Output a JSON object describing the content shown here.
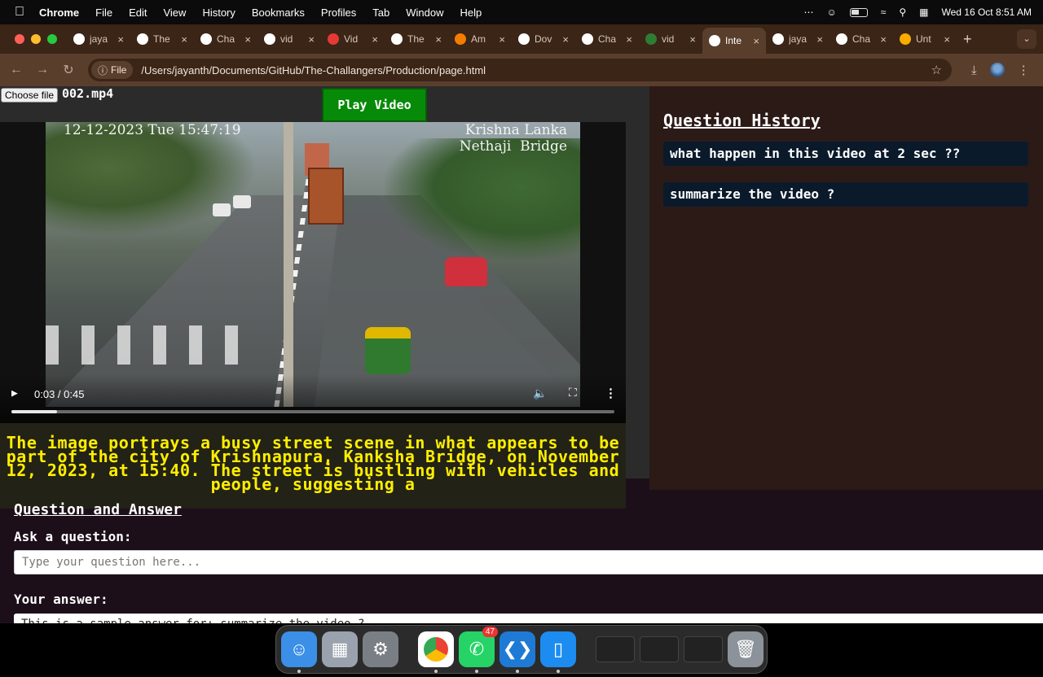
{
  "menubar": {
    "app_name": "Chrome",
    "items": [
      "File",
      "Edit",
      "View",
      "History",
      "Bookmarks",
      "Profiles",
      "Tab",
      "Window",
      "Help"
    ],
    "datetime": "Wed 16 Oct  8:51 AM"
  },
  "tabs": [
    {
      "title": "jaya",
      "icon": "github-icon",
      "color": "#ffffff"
    },
    {
      "title": "The",
      "icon": "github-icon",
      "color": "#ffffff"
    },
    {
      "title": "Cha",
      "icon": "openai-icon",
      "color": "#ffffff"
    },
    {
      "title": "vid",
      "icon": "github-icon",
      "color": "#ffffff"
    },
    {
      "title": "Vid",
      "icon": "video-icon",
      "color": "#e53935"
    },
    {
      "title": "The",
      "icon": "github-icon",
      "color": "#ffffff"
    },
    {
      "title": "Am",
      "icon": "cube-icon",
      "color": "#f57c00"
    },
    {
      "title": "Dov",
      "icon": "download-icon",
      "color": "#ffffff"
    },
    {
      "title": "Cha",
      "icon": "openai-icon",
      "color": "#ffffff"
    },
    {
      "title": "vid",
      "icon": "doc-icon",
      "color": "#2e7d32"
    },
    {
      "title": "Inte",
      "icon": "globe-icon",
      "color": "#ffffff",
      "active": true
    },
    {
      "title": "jaya",
      "icon": "github-icon",
      "color": "#ffffff"
    },
    {
      "title": "Cha",
      "icon": "openai-icon",
      "color": "#ffffff"
    },
    {
      "title": "Unt",
      "icon": "colab-icon",
      "color": "#f9ab00"
    }
  ],
  "address": {
    "chip_label": "File",
    "url": "/Users/jayanth/Documents/GitHub/The-Challangers/Production/page.html"
  },
  "page": {
    "choose_file_label": "Choose file",
    "file_name": "002.mp4",
    "play_button_label": "Play Video",
    "video": {
      "timestamp_overlay": "12-12-2023 Tue 15:47:19",
      "location_overlay": "Krishna Lanka\nNethaji  Bridge",
      "time_display": "0:03 / 0:45",
      "progress": 0.075
    },
    "caption": "The image portrays a busy street scene in what appears to be part of the city of Krishnapura, Kanksha Bridge, on November 12, 2023, at 15:40. The street is bustling with vehicles and people, suggesting a",
    "qa_heading": "Question and Answer",
    "ask_label": "Ask a question:",
    "ask_placeholder": "Type your question here...",
    "answer_label": "Your answer:",
    "answer_text": "This is a sample answer for: summarize the video ?",
    "history_title": "Question History",
    "history": [
      "what happen in this video at 2 sec ??",
      "summarize the video ?"
    ]
  },
  "dock": {
    "apps": [
      {
        "name": "finder-icon",
        "color": "#3b8fe6"
      },
      {
        "name": "launchpad-icon",
        "color": "#9aa2ad"
      },
      {
        "name": "system-settings-icon",
        "color": "#7a7f86"
      },
      {
        "name": "chrome-icon",
        "color": "#ffffff"
      },
      {
        "name": "whatsapp-icon",
        "color": "#25d366",
        "badge": "47"
      },
      {
        "name": "vscode-icon",
        "color": "#1f7ad6"
      },
      {
        "name": "keynote-icon",
        "color": "#1d8cf0"
      }
    ]
  }
}
